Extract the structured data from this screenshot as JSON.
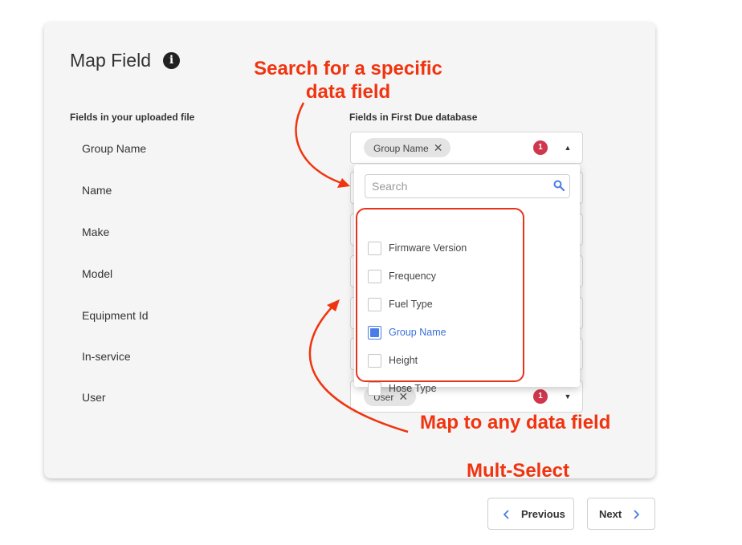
{
  "modal": {
    "title": "Map Field",
    "left_column_header": "Fields in your uploaded file",
    "right_column_header": "Fields in First Due database"
  },
  "rows": [
    {
      "label": "Group Name"
    },
    {
      "label": "Name"
    },
    {
      "label": "Make"
    },
    {
      "label": "Model"
    },
    {
      "label": "Equipment Id"
    },
    {
      "label": "In-service"
    },
    {
      "label": "User"
    }
  ],
  "first_select": {
    "chip": "Group Name",
    "count": "1"
  },
  "last_select": {
    "chip": "User",
    "count": "1"
  },
  "dropdown": {
    "search_placeholder": "Search",
    "options": [
      {
        "label": "Firmware Version",
        "checked": false
      },
      {
        "label": "Frequency",
        "checked": false
      },
      {
        "label": "Fuel Type",
        "checked": false
      },
      {
        "label": "Group Name",
        "checked": true
      },
      {
        "label": "Height",
        "checked": false
      },
      {
        "label": "Hose Type",
        "checked": false
      }
    ]
  },
  "annotations": {
    "search_line1": "Search for a specific",
    "search_line2": "data field",
    "map_any": "Map to any data field",
    "multi_select": "Mult-Select"
  },
  "footer": {
    "previous_label": "Previous",
    "next_label": "Next"
  },
  "colors": {
    "accent": "#4a7de8",
    "badge": "#d0374d",
    "annotation": "#f0340f"
  },
  "icons": [
    "info-icon",
    "close-icon",
    "caret-up-icon",
    "caret-down-icon",
    "search-icon",
    "chevron-left-icon",
    "chevron-right-icon"
  ]
}
